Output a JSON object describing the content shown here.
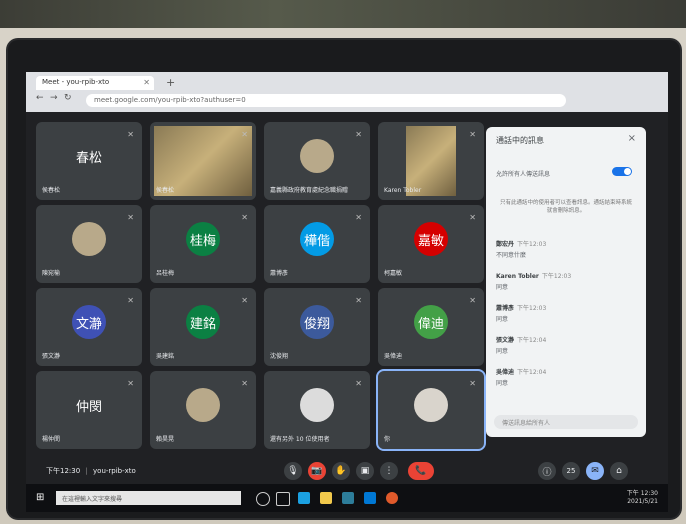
{
  "browser": {
    "tab_title": "Meet - you-rpib-xto",
    "url": "meet.google.com/you-rpib-xto?authuser=0",
    "new_tab": "+"
  },
  "tiles": [
    {
      "name": "侯春松",
      "avatar": "春松",
      "color": "#3c4043"
    },
    {
      "name": "侯春松",
      "avatar": "",
      "color": "video"
    },
    {
      "name": "嘉義縣政府教育處紀念職捐贈",
      "avatar": "",
      "color": "photo"
    },
    {
      "name": "Karen Tobler",
      "avatar": "",
      "color": "video"
    },
    {
      "name": "陳宛榆",
      "avatar": "",
      "color": "photo"
    },
    {
      "name": "呂桂梅",
      "avatar": "桂梅",
      "color": "#0b8043"
    },
    {
      "name": "蕭博彥",
      "avatar": "樺偕",
      "color": "#039be5"
    },
    {
      "name": "柯嘉敏",
      "avatar": "嘉敏",
      "color": "#d50000"
    },
    {
      "name": "張文瀞",
      "avatar": "文瀞",
      "color": "#3f51b5"
    },
    {
      "name": "吳建銘",
      "avatar": "建銘",
      "color": "#0b8043"
    },
    {
      "name": "沈俊翔",
      "avatar": "俊翔",
      "color": "#3c5a9c"
    },
    {
      "name": "吳偉迪",
      "avatar": "偉迪",
      "color": "#43a047"
    },
    {
      "name": "楊仲閔",
      "avatar": "仲閔",
      "color": "#3c4043"
    },
    {
      "name": "賴昊晃",
      "avatar": "",
      "color": "photo"
    },
    {
      "name": "還有另外 10 位使用者",
      "avatar": "",
      "color": "more"
    },
    {
      "name": "你",
      "avatar": "",
      "color": "self"
    }
  ],
  "panel": {
    "title": "通話中的訊息",
    "close": "×",
    "toggle_label": "允許所有人傳送訊息",
    "notice": "只有此通話中的使用者可以查看訊息。通話結束時系統就會刪除訊息。",
    "messages": [
      {
        "who": "鄭宏丹",
        "time": "下午12:03",
        "text": "不同意什麼"
      },
      {
        "who": "Karen Tobler",
        "time": "下午12:03",
        "text": "同意"
      },
      {
        "who": "蕭博彥",
        "time": "下午12:03",
        "text": "同意"
      },
      {
        "who": "張文瀞",
        "time": "下午12:04",
        "text": "同意"
      },
      {
        "who": "吳偉迪",
        "time": "下午12:04",
        "text": "同意"
      }
    ],
    "composer_placeholder": "傳送訊息給所有人"
  },
  "toolbar": {
    "time": "下午12:30",
    "meeting_code": "you-rpib-xto",
    "mic_icon": "🎙",
    "cam_icon": "📷",
    "hand_icon": "✋",
    "present_icon": "▣",
    "more_icon": "⋮",
    "end_icon": "📞",
    "info_icon": "ⓘ",
    "people_count": "25"
  },
  "taskbar": {
    "search_placeholder": "在這裡輸入文字來搜尋",
    "clock_time": "下午 12:30",
    "clock_date": "2021/5/21"
  }
}
